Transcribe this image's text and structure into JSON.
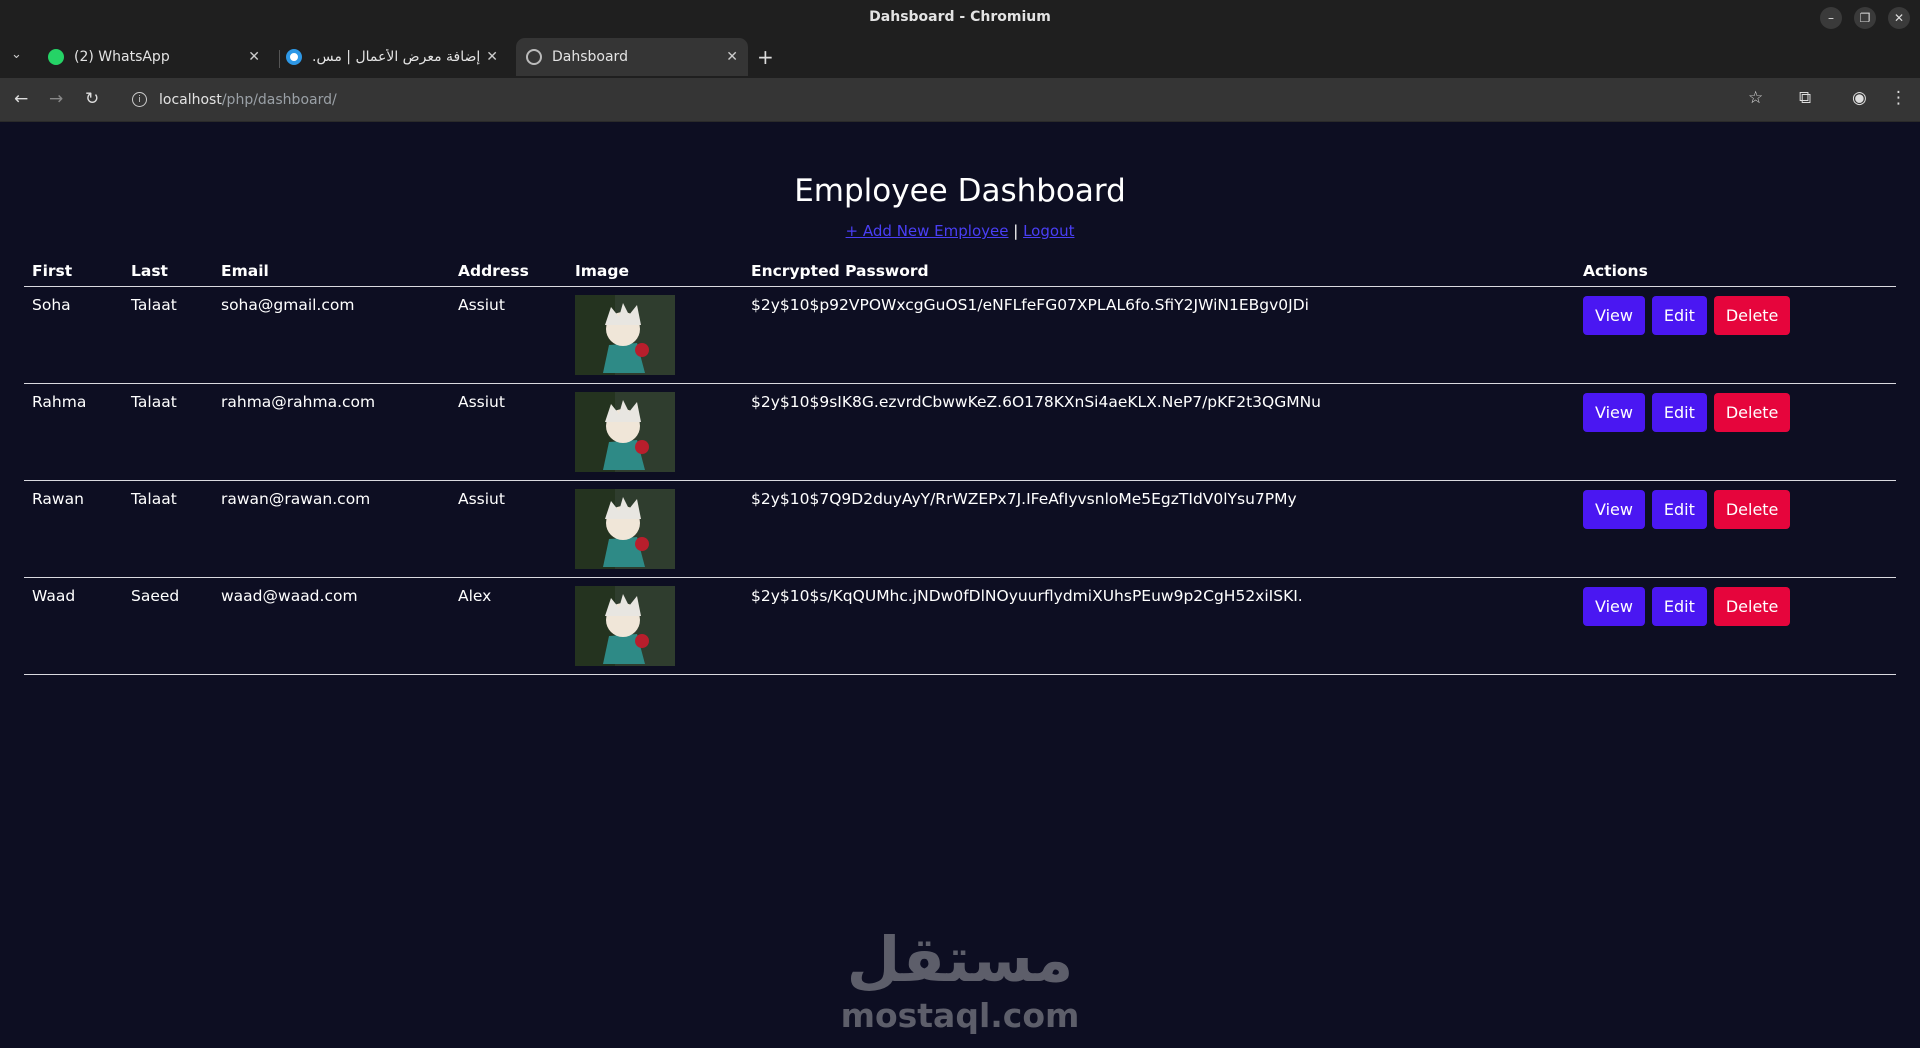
{
  "window": {
    "title": "Dahsboard - Chromium"
  },
  "tabs": [
    {
      "label": "(2) WhatsApp",
      "icon": "whatsapp-icon",
      "active": false
    },
    {
      "label": "إضافة معرض الأعمال | مس...",
      "icon": "mostaql-icon",
      "active": false
    },
    {
      "label": "Dahsboard",
      "icon": "globe-icon",
      "active": true
    }
  ],
  "address": {
    "host": "localhost",
    "path": "/php/dashboard/"
  },
  "page": {
    "title": "Employee Dashboard",
    "add_link": "+ Add New Employee",
    "separator": "|",
    "logout_link": "Logout"
  },
  "table": {
    "headers": [
      "First",
      "Last",
      "Email",
      "Address",
      "Image",
      "Encrypted Password",
      "Actions"
    ],
    "rows": [
      {
        "first": "Soha",
        "last": "Talaat",
        "email": "soha@gmail.com",
        "address": "Assiut",
        "password": "$2y$10$p92VPOWxcgGuOS1/eNFLfeFG07XPLAL6fo.SfiY2JWiN1EBgv0JDi"
      },
      {
        "first": "Rahma",
        "last": "Talaat",
        "email": "rahma@rahma.com",
        "address": "Assiut",
        "password": "$2y$10$9sIK8G.ezvrdCbwwKeZ.6O178KXnSi4aeKLX.NeP7/pKF2t3QGMNu"
      },
      {
        "first": "Rawan",
        "last": "Talaat",
        "email": "rawan@rawan.com",
        "address": "Assiut",
        "password": "$2y$10$7Q9D2duyAyY/RrWZEPx7J.IFeAfIyvsnloMe5EgzTIdV0lYsu7PMy"
      },
      {
        "first": "Waad",
        "last": "Saeed",
        "email": "waad@waad.com",
        "address": "Alex",
        "password": "$2y$10$s/KqQUMhc.jNDw0fDlNOyuurflydmiXUhsPEuw9p2CgH52xiISKI."
      }
    ],
    "actions": {
      "view": "View",
      "edit": "Edit",
      "delete": "Delete"
    }
  },
  "watermark": {
    "arabic": "مستقل",
    "latin": "mostaql.com"
  },
  "colors": {
    "page_bg": "#0d0e22",
    "link": "#4a3ff5",
    "primary_btn": "#4a17f2",
    "danger_btn": "#e6053c"
  }
}
